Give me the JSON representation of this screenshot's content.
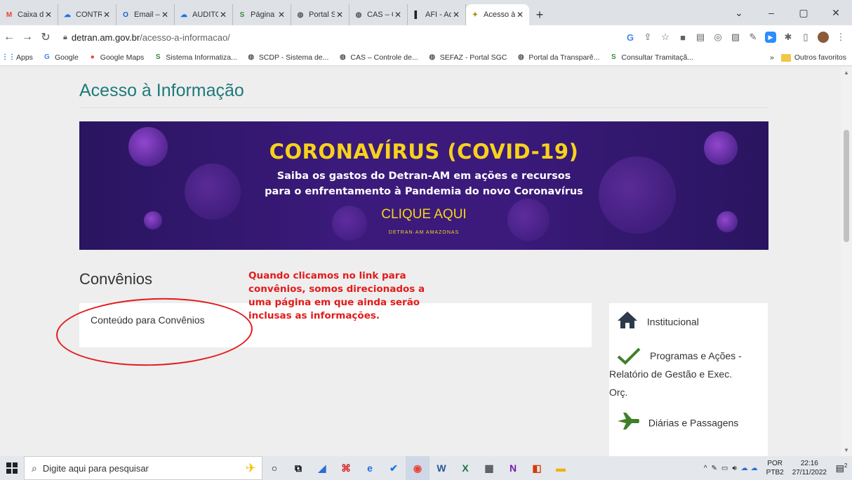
{
  "browser": {
    "tabs": [
      {
        "label": "Caixa de e",
        "favicon": "M",
        "color": "#ea4335"
      },
      {
        "label": "CONTROL",
        "favicon": "☁",
        "color": "#1a73e8"
      },
      {
        "label": "Email – Ma",
        "favicon": "O",
        "color": "#0a64d2"
      },
      {
        "label": "AUDITORI",
        "favicon": "☁",
        "color": "#1a73e8"
      },
      {
        "label": "Página prin",
        "favicon": "S",
        "color": "#3a8a3a"
      },
      {
        "label": "Portal SGC",
        "favicon": "◍",
        "color": "#555555"
      },
      {
        "label": "CAS – Con",
        "favicon": "◍",
        "color": "#555555"
      },
      {
        "label": "AFI - Adm",
        "favicon": "▌",
        "color": "#222222"
      },
      {
        "label": "Acesso à I",
        "favicon": "✦",
        "color": "#b08b00",
        "active": true
      }
    ],
    "new_tab": "+",
    "window_controls": {
      "dropdown": "⌄",
      "minimize": "–",
      "maximize": "▢",
      "close": "✕"
    },
    "url_host": "detran.am.gov.br",
    "url_path": "/acesso-a-informacao/",
    "bookmarks": [
      {
        "label": "Apps",
        "icon": "apps-grid-icon",
        "glyph": "⋮⋮",
        "color": "#1a73e8"
      },
      {
        "label": "Google",
        "icon": "google-icon",
        "glyph": "G",
        "color": "#4285f4"
      },
      {
        "label": "Google Maps",
        "icon": "maps-pin-icon",
        "glyph": "●",
        "color": "#ea4335"
      },
      {
        "label": "Sistema Informatiza...",
        "icon": "leaf-icon",
        "glyph": "S",
        "color": "#3a8a3a"
      },
      {
        "label": "SCDP - Sistema de...",
        "icon": "globe-icon",
        "glyph": "◍",
        "color": "#555555"
      },
      {
        "label": "CAS – Controle de...",
        "icon": "globe-icon",
        "glyph": "◍",
        "color": "#555555"
      },
      {
        "label": "SEFAZ - Portal SGC",
        "icon": "globe-icon",
        "glyph": "◍",
        "color": "#555555"
      },
      {
        "label": "Portal da Transparê...",
        "icon": "globe-icon",
        "glyph": "◍",
        "color": "#555555"
      },
      {
        "label": "Consultar Tramitaçã...",
        "icon": "leaf-icon",
        "glyph": "S",
        "color": "#3a8a3a"
      }
    ],
    "bookmarks_more": "»",
    "other_bookmarks": "Outros favoritos"
  },
  "page": {
    "title": "Acesso à Informação",
    "banner": {
      "headline": "CORONAVÍRUS (COVID-19)",
      "line1": "Saiba os gastos do Detran-AM em ações e recursos",
      "line2": "para o enfrentamento à Pandemia do novo Coronavírus",
      "cta": "CLIQUE AQUI",
      "logos": "DETRAN·AM   AMAZONAS"
    },
    "section_title": "Convênios",
    "content_text": "Conteúdo para Convênios",
    "annotation": "Quando clicamos no link para convênios, somos direcionados a uma página em que ainda serão inclusas as informações.",
    "sidebar": [
      {
        "label": "Institucional",
        "icon": "home-icon"
      },
      {
        "label": "Programas e Ações - Relatório de Gestão e Exec. Orç.",
        "icon": "checkmark-icon"
      },
      {
        "label": "Diárias e Passagens",
        "icon": "airplane-icon"
      }
    ]
  },
  "taskbar": {
    "search_placeholder": "Digite aqui para pesquisar",
    "language": "POR",
    "keyboard": "PTB2",
    "time": "22:16",
    "date": "27/11/2022",
    "notifications": "2"
  },
  "colors": {
    "title": "#1f7a7a",
    "annotation": "#e21b1b",
    "banner_yellow": "#f7d21b",
    "banner_purple": "#3b1a7c"
  }
}
